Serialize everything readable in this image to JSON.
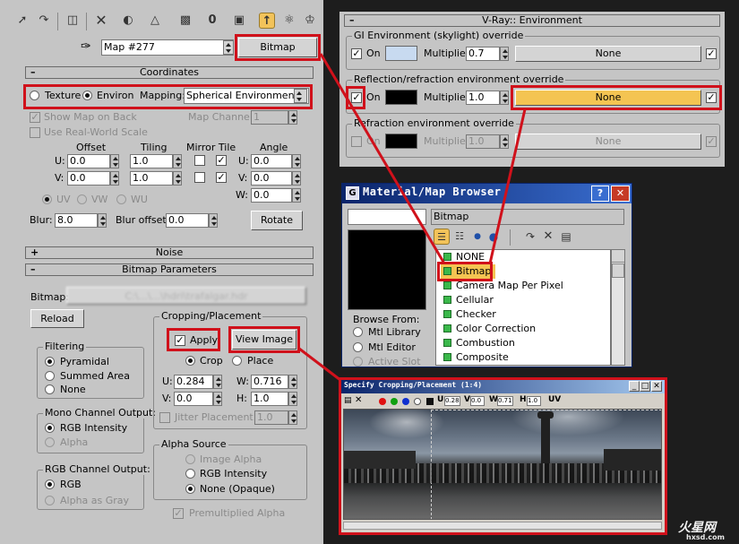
{
  "toolbar": {
    "icons": [
      "pick-material-icon",
      "put-to-scene-icon",
      "assign-material-icon",
      "reset-map-icon",
      "copy-material-icon",
      "make-unique-icon",
      "put-to-library-icon",
      "material-id-icon",
      "show-map-icon",
      "show-end-result-icon",
      "go-to-parent-icon",
      "go-forward-icon"
    ]
  },
  "map": {
    "name": "Map #277",
    "type_button": "Bitmap"
  },
  "coordinates": {
    "title": "Coordinates",
    "texture_label": "Texture",
    "environ_label": "Environ",
    "mapping_label": "Mapping:",
    "mapping_value": "Spherical Environment",
    "show_map_on_back": "Show Map on Back",
    "map_channel_label": "Map Channel:",
    "map_channel_value": "1",
    "real_world_scale": "Use Real-World Scale",
    "offset_label": "Offset",
    "tiling_label": "Tiling",
    "mirror_tile_label": "Mirror Tile",
    "angle_label": "Angle",
    "u_label": "U:",
    "v_label": "V:",
    "w_label": "W:",
    "u_offset": "0.0",
    "v_offset": "0.0",
    "u_tiling": "1.0",
    "v_tiling": "1.0",
    "u_angle": "0.0",
    "v_angle": "0.0",
    "w_angle": "0.0",
    "uv": "UV",
    "vw": "VW",
    "wu": "WU",
    "blur_label": "Blur:",
    "blur_value": "8.0",
    "blur_offset_label": "Blur offset:",
    "blur_offset_value": "0.0",
    "rotate": "Rotate"
  },
  "noise": {
    "title": "Noise"
  },
  "bitmap_params": {
    "title": "Bitmap Parameters",
    "bitmap_label": "Bitmap:",
    "bitmap_path": "C:\\...\\...\\hdri\\trafalgar.hdr",
    "reload": "Reload",
    "filtering": "Filtering",
    "pyramidal": "Pyramidal",
    "summed_area": "Summed Area",
    "none": "None",
    "mono_output": "Mono Channel Output:",
    "rgb_intensity": "RGB Intensity",
    "alpha": "Alpha",
    "rgb_output": "RGB Channel Output:",
    "rgb": "RGB",
    "alpha_as_gray": "Alpha as Gray",
    "cropping": "Cropping/Placement",
    "apply": "Apply",
    "view_image": "View Image",
    "crop": "Crop",
    "place": "Place",
    "u_label": "U:",
    "v_label": "V:",
    "w_label": "W:",
    "h_label": "H:",
    "u_value": "0.284",
    "v_value": "0.0",
    "w_value": "0.716",
    "h_value": "1.0",
    "jitter": "Jitter Placement:",
    "jitter_value": "1.0",
    "alpha_source": "Alpha Source",
    "image_alpha": "Image Alpha",
    "rgb_intensity2": "RGB Intensity",
    "none_opaque": "None (Opaque)",
    "premultiplied": "Premultiplied Alpha"
  },
  "vray": {
    "title": "V-Ray:: Environment",
    "gi_label": "GI Environment (skylight) override",
    "refl_label": "Reflection/refraction environment override",
    "refr_label": "Refraction environment override",
    "on": "On",
    "multiplier": "Multiplier:",
    "gi_mult": "0.7",
    "refl_mult": "1.0",
    "refr_mult": "1.0",
    "none": "None"
  },
  "browser": {
    "title": "Material/Map Browser",
    "current": "Bitmap",
    "browse_from": "Browse From:",
    "sources": [
      "Mtl Library",
      "Mtl Editor",
      "Active Slot"
    ],
    "items": [
      "NONE",
      "Bitmap",
      "Camera Map Per Pixel",
      "Cellular",
      "Checker",
      "Color Correction",
      "Combustion",
      "Composite"
    ]
  },
  "crop_window": {
    "title": "Specify Cropping/Placement (1:4)",
    "u": "U",
    "u_value": "0.28",
    "v": "V",
    "v_value": "0.0",
    "w": "W",
    "w_value": "0.71",
    "h": "H",
    "h_value": "1.0",
    "uv": "UV"
  },
  "watermark": {
    "text": "火星网",
    "url": "hxsd.com"
  },
  "colors": {
    "highlight_red": "#d0111b",
    "panel": "#c5c5c5",
    "selected_yellow": "#f4c452"
  }
}
